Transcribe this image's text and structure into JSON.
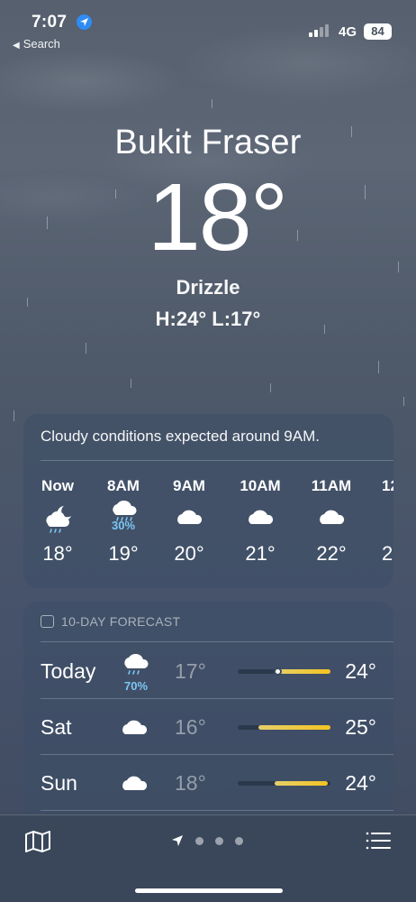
{
  "status_bar": {
    "time": "7:07",
    "back_label": "Search",
    "network": "4G",
    "battery": "84"
  },
  "current": {
    "city": "Bukit Fraser",
    "temperature": "18°",
    "condition": "Drizzle",
    "high_low": "H:24°  L:17°"
  },
  "hourly": {
    "summary": "Cloudy conditions expected around 9AM.",
    "items": [
      {
        "label": "Now",
        "icon": "partly-cloudy-night-icon",
        "precip": "",
        "temp": "18°"
      },
      {
        "label": "8AM",
        "icon": "rain-cloud-icon",
        "precip": "30%",
        "temp": "19°"
      },
      {
        "label": "9AM",
        "icon": "cloud-icon",
        "precip": "",
        "temp": "20°"
      },
      {
        "label": "10AM",
        "icon": "cloud-icon",
        "precip": "",
        "temp": "21°"
      },
      {
        "label": "11AM",
        "icon": "cloud-icon",
        "precip": "",
        "temp": "22°"
      },
      {
        "label": "12",
        "icon": "cloud-icon",
        "precip": "",
        "temp": "2"
      }
    ]
  },
  "ten_day": {
    "header": "10-DAY FORECAST",
    "rows": [
      {
        "day": "Today",
        "icon": "rain-cloud-icon",
        "precip": "70%",
        "low": "17°",
        "high": "24°",
        "bar_start": 0.4,
        "bar_end": 1.0,
        "current_marker": 0.43
      },
      {
        "day": "Sat",
        "icon": "cloud-icon",
        "precip": "",
        "low": "16°",
        "high": "25°",
        "bar_start": 0.22,
        "bar_end": 1.0
      },
      {
        "day": "Sun",
        "icon": "cloud-icon",
        "precip": "",
        "low": "18°",
        "high": "24°",
        "bar_start": 0.4,
        "bar_end": 0.97
      }
    ]
  },
  "colors": {
    "precip_text": "#7cc6f4",
    "temp_bar": "#f4c322",
    "location_arrow": "#2f8cf5"
  }
}
